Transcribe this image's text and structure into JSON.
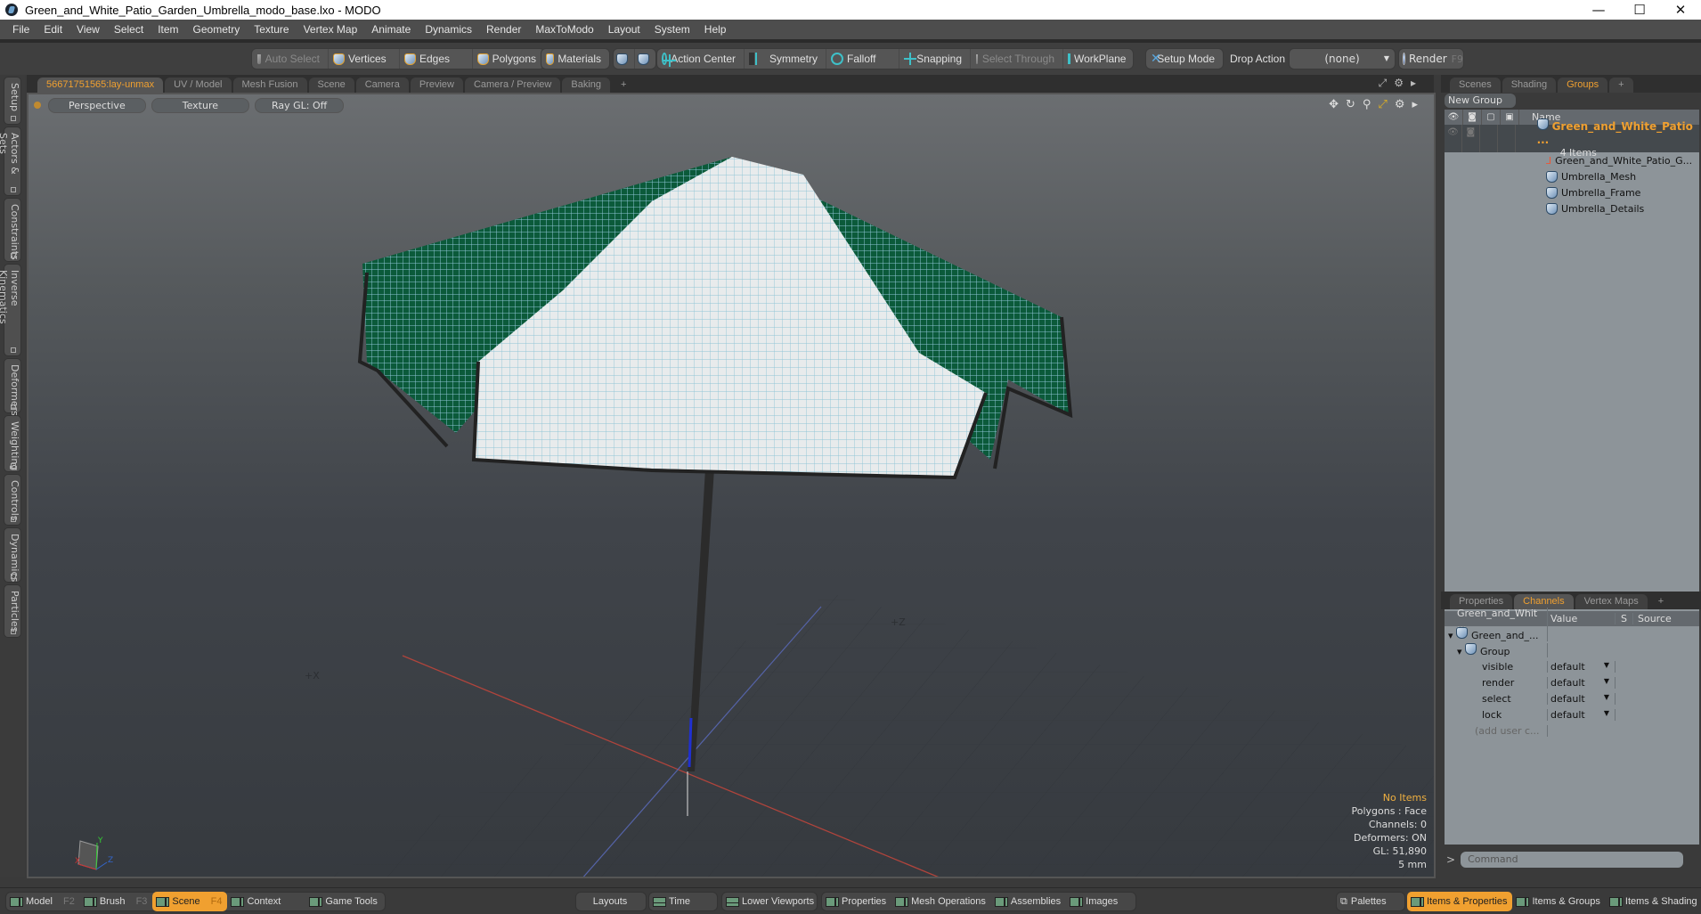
{
  "window": {
    "title": "Green_and_White_Patio_Garden_Umbrella_modo_base.lxo - MODO",
    "controls": [
      "—",
      "☐",
      "✕"
    ]
  },
  "menu": [
    "File",
    "Edit",
    "View",
    "Select",
    "Item",
    "Geometry",
    "Texture",
    "Vertex Map",
    "Animate",
    "Dynamics",
    "Render",
    "MaxToModo",
    "Layout",
    "System",
    "Help"
  ],
  "toolbar": {
    "selection_modes": [
      "Auto Select",
      "Vertices",
      "Edges",
      "Polygons"
    ],
    "materials": "Materials",
    "action_center": "Action Center",
    "symmetry": "Symmetry",
    "falloff": "Falloff",
    "snapping": "Snapping",
    "select_through": "Select Through",
    "workplane": "WorkPlane",
    "setup_mode": "Setup Mode",
    "drop_action_label": "Drop Action",
    "drop_action_value": "(none)",
    "render_label": "Render",
    "render_key": "F9"
  },
  "left_tabs": [
    "Setup",
    "Actors & Sets",
    "Constraints",
    "Inverse Kinematics",
    "Deformers",
    "Weighting",
    "Controls",
    "Dynamics",
    "Particles"
  ],
  "viewport_tabs": [
    "56671751565:lay-unmax",
    "UV / Model",
    "Mesh Fusion",
    "Scene",
    "Camera",
    "Preview",
    "Camera / Preview",
    "Baking",
    "+"
  ],
  "viewport": {
    "view_mode": "Perspective",
    "shading": "Texture",
    "raygl": "Ray GL: Off",
    "axis_x_label": "+X",
    "axis_z_label": "+Z",
    "gizmo": {
      "x": "X",
      "y": "Y",
      "z": "Z"
    },
    "stats": {
      "selection": "No Items",
      "polygons": "Polygons : Face",
      "channels": "Channels: 0",
      "deformers": "Deformers: ON",
      "gl": "GL: 51,890",
      "unit": "5 mm"
    }
  },
  "right_tabs": [
    "Scenes",
    "Shading",
    "Groups",
    "+"
  ],
  "groups": {
    "new_group": "New Group",
    "name_header": "Name",
    "root": {
      "name": "Green_and_White_Patio ...",
      "count": "4 Items"
    },
    "children": [
      "Green_and_White_Patio_G...",
      "Umbrella_Mesh",
      "Umbrella_Frame",
      "Umbrella_Details"
    ]
  },
  "props_tabs": [
    "Properties",
    "Channels",
    "Vertex Maps",
    "+"
  ],
  "channels": {
    "headers": [
      "Green_and_Whit ...",
      "Value",
      "S",
      "Source"
    ],
    "item": "Green_and_...",
    "group": "Group",
    "rows": [
      {
        "name": "visible",
        "value": "default"
      },
      {
        "name": "render",
        "value": "default"
      },
      {
        "name": "select",
        "value": "default"
      },
      {
        "name": "lock",
        "value": "default"
      }
    ],
    "add_user": "(add user c..."
  },
  "command": {
    "prompt": ">",
    "placeholder": "Command"
  },
  "status_left": [
    {
      "label": "Model",
      "key": "F2"
    },
    {
      "label": "Brush",
      "key": "F3"
    },
    {
      "label": "Scene",
      "key": "F4",
      "active": true
    },
    {
      "label": "Context"
    },
    {
      "label": "Game Tools"
    }
  ],
  "status_mid": [
    "Layouts",
    "Time",
    "Lower Viewports",
    "Properties",
    "Mesh Operations",
    "Assemblies",
    "Images"
  ],
  "status_right": [
    "Palettes",
    "Items & Properties",
    "Items & Groups",
    "Items & Shading"
  ],
  "colors": {
    "accent": "#f0a030",
    "umbrella_green": "#0b5a3a",
    "wire": "#8fc4d6"
  }
}
